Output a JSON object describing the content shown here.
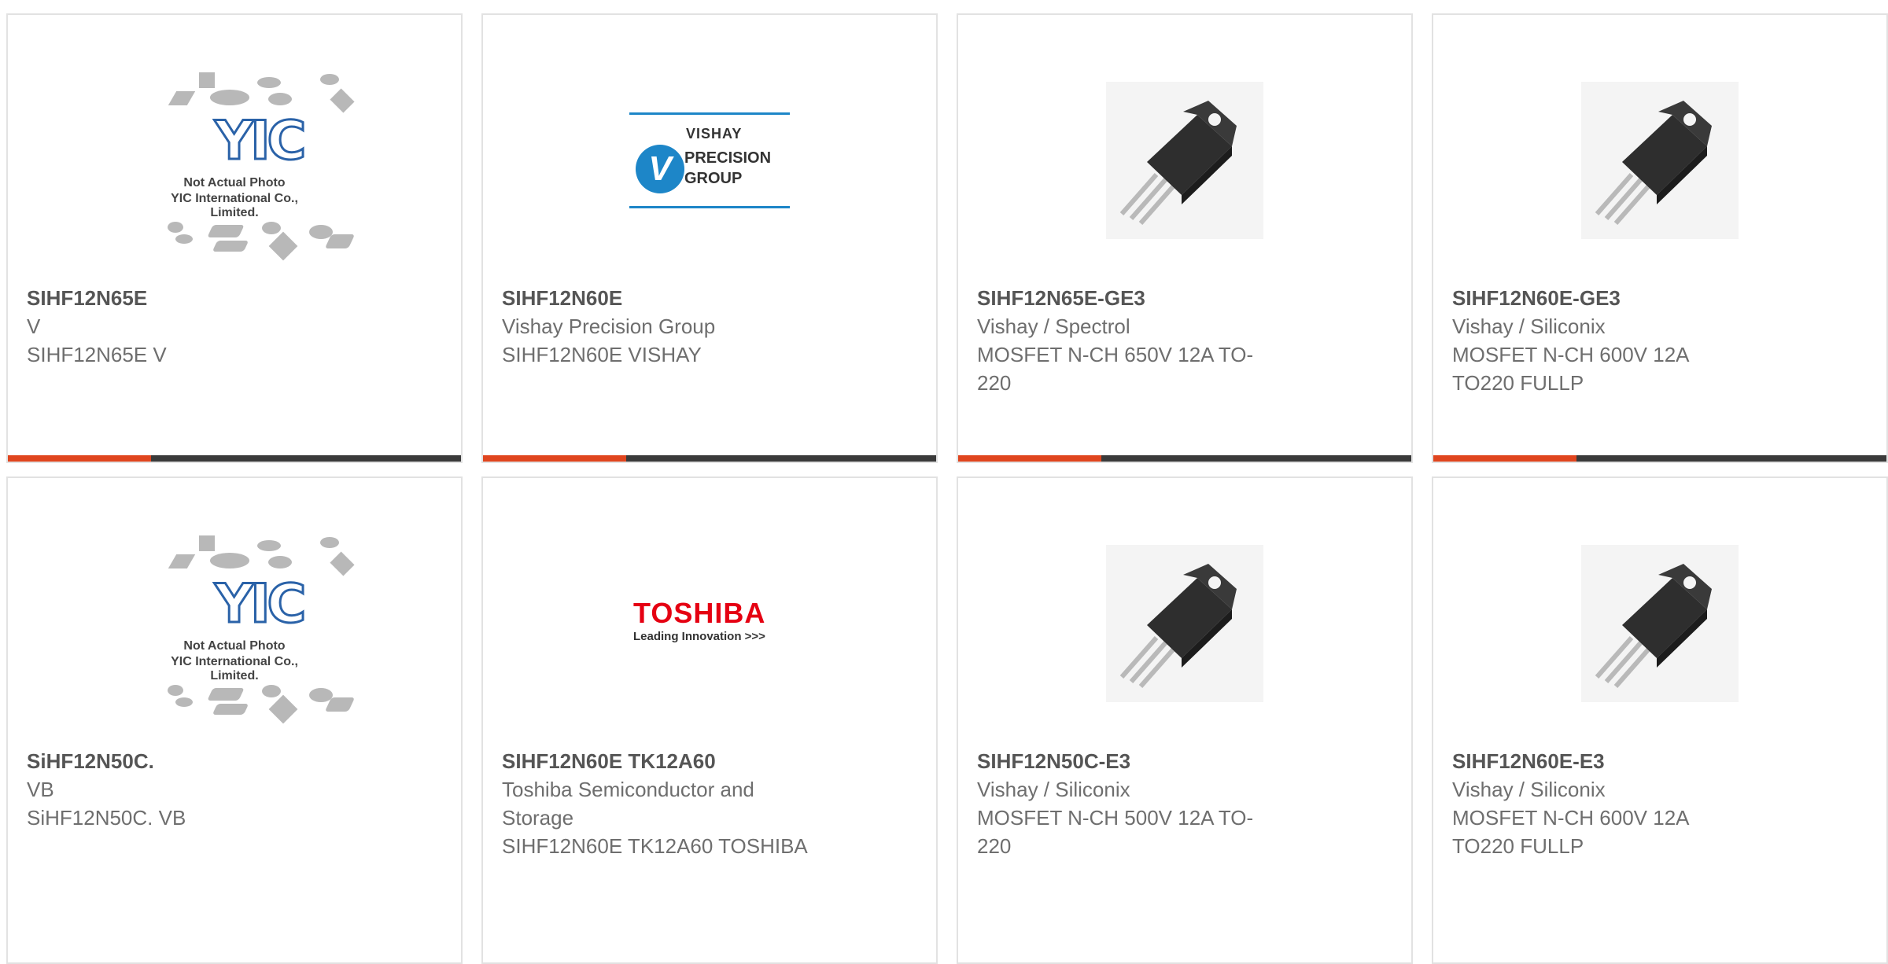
{
  "cards": [
    {
      "part": "SIHF12N65E",
      "manufacturer": "V",
      "desc": "SIHF12N65E V",
      "desc2": "",
      "image": "yic-placeholder",
      "placeholder": {
        "line1": "Not Actual Photo",
        "line2": "YIC International Co., Limited."
      }
    },
    {
      "part": "SIHF12N60E",
      "manufacturer": "Vishay Precision Group",
      "desc": "SIHF12N60E VISHAY",
      "desc2": "",
      "image": "vishay-precision-group-logo",
      "logo": {
        "w1": "VISHAY",
        "w2": "PRECISION",
        "w3": "GROUP"
      }
    },
    {
      "part": "SIHF12N65E-GE3",
      "manufacturer": "Vishay / Spectrol",
      "desc": "MOSFET N-CH 650V 12A TO-",
      "desc2": "220",
      "image": "to220-package"
    },
    {
      "part": "SIHF12N60E-GE3",
      "manufacturer": "Vishay / Siliconix",
      "desc": "MOSFET N-CH 600V 12A",
      "desc2": "TO220 FULLP",
      "image": "to220-package"
    },
    {
      "part": "SiHF12N50C.",
      "manufacturer": "VB",
      "desc": "SiHF12N50C. VB",
      "desc2": "",
      "image": "yic-placeholder",
      "placeholder": {
        "line1": "Not Actual Photo",
        "line2": "YIC International Co., Limited."
      }
    },
    {
      "part": "SIHF12N60E TK12A60",
      "manufacturer": "Toshiba Semiconductor and",
      "manufacturer2": "Storage",
      "desc": "SIHF12N60E TK12A60 TOSHIBA",
      "desc2": "",
      "image": "toshiba-logo",
      "logo": {
        "brand": "TOSHIBA",
        "tag": "Leading Innovation >>>"
      }
    },
    {
      "part": "SIHF12N50C-E3",
      "manufacturer": "Vishay / Siliconix",
      "desc": "MOSFET N-CH 500V 12A TO-",
      "desc2": "220",
      "image": "to220-package"
    },
    {
      "part": "SIHF12N60E-E3",
      "manufacturer": "Vishay / Siliconix",
      "desc": "MOSFET N-CH 600V 12A",
      "desc2": "TO220 FULLP",
      "image": "to220-package"
    }
  ],
  "colors": {
    "accent": "#e0451e",
    "bar": "#3a3a3a",
    "border": "#e2e2e2",
    "text": "#6e6e6e",
    "vishay_blue": "#1d86c8",
    "toshiba_red": "#e50012"
  }
}
